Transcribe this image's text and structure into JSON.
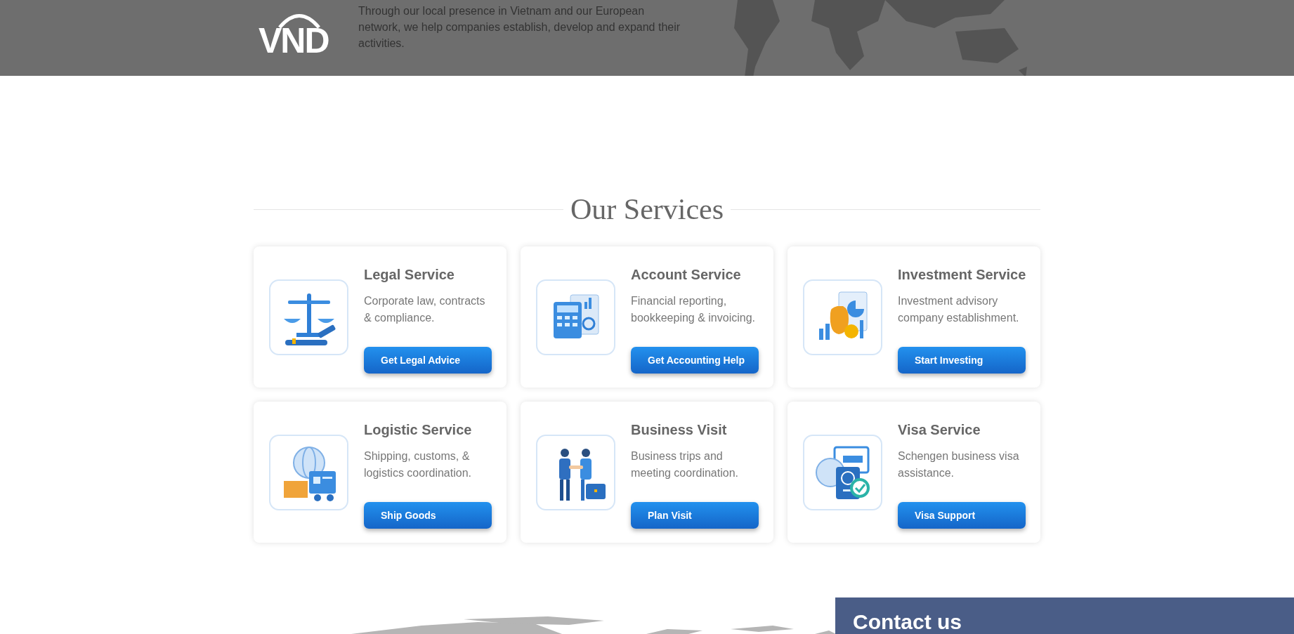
{
  "header": {
    "logo": "VND",
    "intro": "Through our local presence in Vietnam and our European network, we help companies establish, develop and expand their activities."
  },
  "services": {
    "title": "Our Services",
    "cards": [
      {
        "title": "Legal Service",
        "description": "Corporate law, contracts & compliance.",
        "button": "Get Legal Advice"
      },
      {
        "title": "Account Service",
        "description": "Financial reporting, bookkeeping & invoicing.",
        "button": "Get Accounting Help"
      },
      {
        "title": "Investment Service",
        "description": "Investment advisory company establishment.",
        "button": "Start Investing"
      },
      {
        "title": "Logistic Service",
        "description": "Shipping, customs, & logistics coordination.",
        "button": "Ship Goods"
      },
      {
        "title": "Business Visit",
        "description": "Business trips and meeting coordination.",
        "button": "Plan Visit"
      },
      {
        "title": "Visa Service",
        "description": "Schengen business visa assistance.",
        "button": "Visa Support"
      }
    ]
  },
  "contact": {
    "title": "Contact us"
  }
}
